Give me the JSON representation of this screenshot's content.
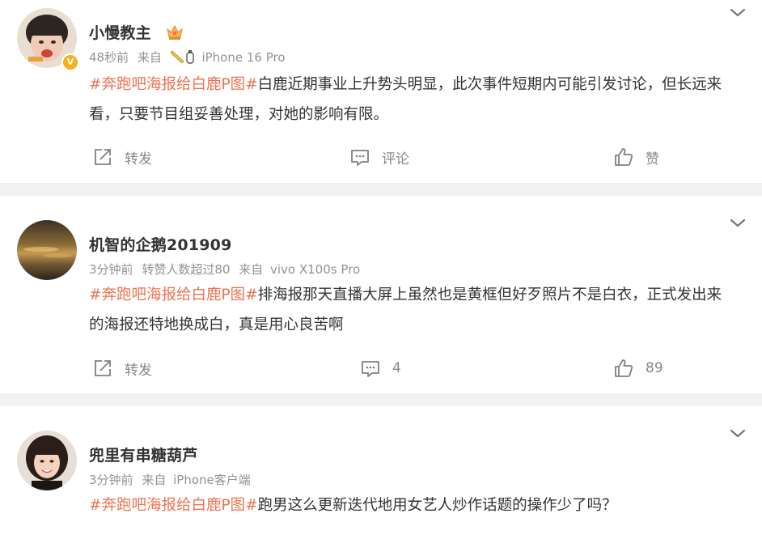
{
  "posts": [
    {
      "username": "小慢教主",
      "time": "48秒前",
      "source_prefix": "来自",
      "device": "iPhone 16 Pro",
      "extra": "",
      "hashtag": "#奔跑吧海报给白鹿P图#",
      "text": "白鹿近期事业上升势头明显，此次事件短期内可能引发讨论，但长远来看，只要节目组妥善处理，对她的影响有限。",
      "repost_label": "转发",
      "comment_label": "评论",
      "like_label": "赞",
      "verified": true
    },
    {
      "username": "机智的企鹅201909",
      "time": "3分钟前",
      "source_prefix": "来自",
      "device": "vivo X100s Pro",
      "extra": "转赞人数超过80",
      "hashtag": "#奔跑吧海报给白鹿P图#",
      "text": "排海报那天直播大屏上虽然也是黄框但好歹照片不是白衣，正式发出来的海报还特地换成白，真是用心良苦啊",
      "repost_label": "转发",
      "comment_label": "4",
      "like_label": "89",
      "verified": false
    },
    {
      "username": "兜里有串糖葫芦",
      "time": "3分钟前",
      "source_prefix": "来自",
      "device": "iPhone客户端",
      "extra": "",
      "hashtag": "#奔跑吧海报给白鹿P图#",
      "text": "跑男这么更新迭代地用女艺人炒作话题的操作少了吗？",
      "verified": false
    }
  ],
  "colors": {
    "hashtag": "#eb7350",
    "meta": "#939393",
    "separator": "#f2f2f2",
    "badge": "#f5b11e"
  },
  "icons": [
    "chevron-down-icon",
    "crown-icon",
    "repost-icon",
    "comment-icon",
    "like-icon"
  ]
}
